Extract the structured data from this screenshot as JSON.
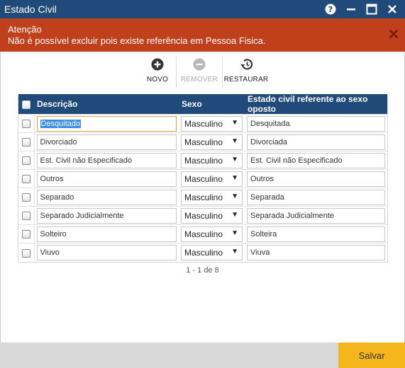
{
  "window": {
    "title": "Estado Civil"
  },
  "alert": {
    "title": "Atenção",
    "message": "Não é possível excluir pois existe referência em Pessoa Fisica."
  },
  "toolbar": {
    "novo_label": "NOVO",
    "remover_label": "REMOVER",
    "restaurar_label": "RESTAURAR"
  },
  "table": {
    "headers": {
      "descricao": "Descrição",
      "sexo": "Sexo",
      "oposto": "Estado civil referente ao sexo oposto"
    },
    "rows": [
      {
        "descricao": "Desquitado",
        "sexo": "Masculino",
        "oposto": "Desquitada"
      },
      {
        "descricao": "Divorciado",
        "sexo": "Masculino",
        "oposto": "Divorciada"
      },
      {
        "descricao": "Est. Civil não Especificado",
        "sexo": "Masculino",
        "oposto": "Est. Civil não Especificado"
      },
      {
        "descricao": "Outros",
        "sexo": "Masculino",
        "oposto": "Outros"
      },
      {
        "descricao": "Separado",
        "sexo": "Masculino",
        "oposto": "Separada"
      },
      {
        "descricao": "Separado Judicialmente",
        "sexo": "Masculino",
        "oposto": "Separada Judicialmente"
      },
      {
        "descricao": "Solteiro",
        "sexo": "Masculino",
        "oposto": "Solteira"
      },
      {
        "descricao": "Viuvo",
        "sexo": "Masculino",
        "oposto": "Viuva"
      }
    ]
  },
  "pager": {
    "text": "1 - 1 de 8"
  },
  "footer": {
    "save_label": "Salvar"
  },
  "colors": {
    "header": "#204a7a",
    "alert": "#c0401c",
    "save": "#f5b51c"
  }
}
